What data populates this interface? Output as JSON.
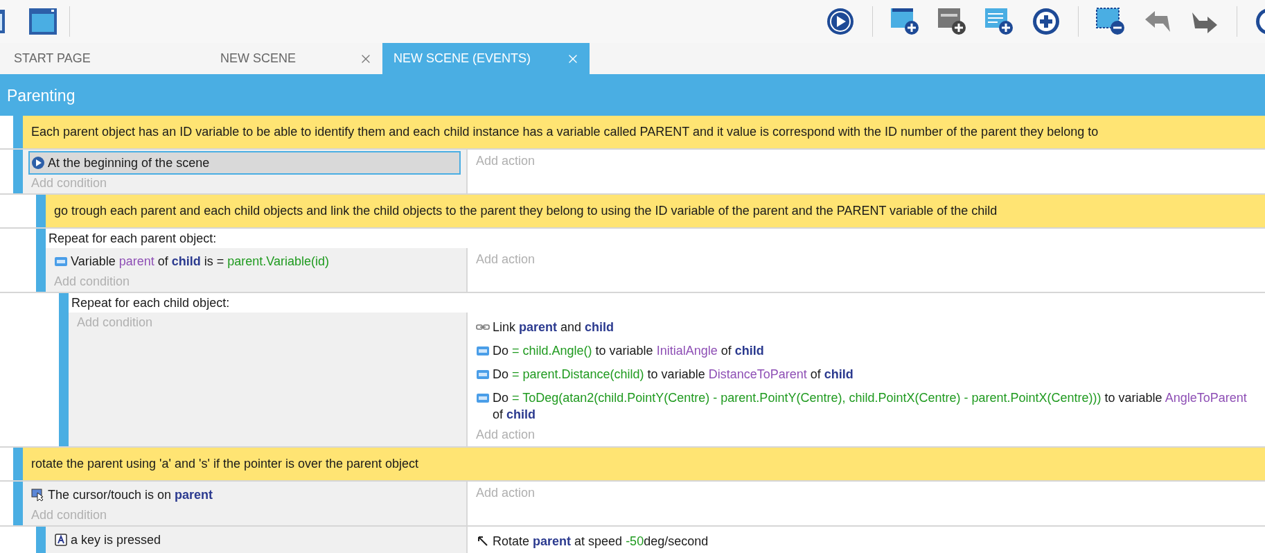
{
  "tabs": [
    {
      "label": "START PAGE",
      "closable": false,
      "selected": false
    },
    {
      "label": "NEW SCENE",
      "closable": true,
      "selected": false
    },
    {
      "label": "NEW SCENE (EVENTS)",
      "closable": true,
      "selected": true
    }
  ],
  "group": {
    "title": "Parenting"
  },
  "events": [
    {
      "kind": "comment",
      "text": "Each parent object has an ID variable to be able to identify them and each child instance has a variable called PARENT and it value is correspond with the ID number of the parent they belong to"
    },
    {
      "kind": "standard",
      "conditions": [
        {
          "kind": "scene",
          "selected": true,
          "parts": [
            {
              "text": "At the beginning of the scene",
              "kind": "plain"
            }
          ]
        }
      ],
      "add_condition": "Add condition",
      "add_action": "Add action",
      "children": [
        {
          "kind": "comment",
          "text": "go trough each parent and each child objects and link the child objects to the parent they belong to using the ID variable of the parent and the PARENT variable of the child"
        },
        {
          "kind": "repeat",
          "header": "Repeat for each parent object:",
          "conditions": [
            {
              "kind": "variable",
              "selected": false,
              "parts": [
                {
                  "text": "Variable ",
                  "kind": "plain"
                },
                {
                  "text": "parent",
                  "kind": "var"
                },
                {
                  "text": " of ",
                  "kind": "plain"
                },
                {
                  "text": "child",
                  "kind": "obj"
                },
                {
                  "text": " is = ",
                  "kind": "plain"
                },
                {
                  "text": "parent.Variable(id)",
                  "kind": "expr"
                }
              ]
            }
          ],
          "add_condition": "Add condition",
          "add_action": "Add action",
          "children": [
            {
              "kind": "repeat",
              "header": "Repeat for each child object:",
              "add_condition": "Add condition",
              "actions": [
                {
                  "kind": "link",
                  "parts": [
                    {
                      "text": "Link ",
                      "kind": "plain"
                    },
                    {
                      "text": "parent",
                      "kind": "obj"
                    },
                    {
                      "text": " and ",
                      "kind": "plain"
                    },
                    {
                      "text": "child",
                      "kind": "obj"
                    }
                  ]
                },
                {
                  "kind": "variable",
                  "parts": [
                    {
                      "text": "Do ",
                      "kind": "plain"
                    },
                    {
                      "text": "= child.Angle()",
                      "kind": "expr"
                    },
                    {
                      "text": " to variable ",
                      "kind": "plain"
                    },
                    {
                      "text": "InitialAngle",
                      "kind": "var"
                    },
                    {
                      "text": " of ",
                      "kind": "plain"
                    },
                    {
                      "text": "child",
                      "kind": "obj"
                    }
                  ]
                },
                {
                  "kind": "variable",
                  "parts": [
                    {
                      "text": "Do ",
                      "kind": "plain"
                    },
                    {
                      "text": "= parent.Distance(child)",
                      "kind": "expr"
                    },
                    {
                      "text": " to variable ",
                      "kind": "plain"
                    },
                    {
                      "text": "DistanceToParent",
                      "kind": "var"
                    },
                    {
                      "text": " of ",
                      "kind": "plain"
                    },
                    {
                      "text": "child",
                      "kind": "obj"
                    }
                  ]
                },
                {
                  "kind": "variable",
                  "parts": [
                    {
                      "text": "Do ",
                      "kind": "plain"
                    },
                    {
                      "text": "= ToDeg(atan2(child.PointY(Centre) - parent.PointY(Centre), child.PointX(Centre) - parent.PointX(Centre)))",
                      "kind": "expr"
                    },
                    {
                      "text": " to variable ",
                      "kind": "plain"
                    },
                    {
                      "text": "AngleToParent",
                      "kind": "var"
                    },
                    {
                      "text": " of ",
                      "kind": "plain"
                    },
                    {
                      "text": "child",
                      "kind": "obj"
                    }
                  ]
                }
              ],
              "add_action": "Add action"
            }
          ]
        }
      ]
    },
    {
      "kind": "comment",
      "text": "rotate the parent using 'a' and 's' if the pointer is over the parent object"
    },
    {
      "kind": "standard",
      "conditions": [
        {
          "kind": "cursor",
          "selected": false,
          "parts": [
            {
              "text": "The cursor/touch is on ",
              "kind": "plain"
            },
            {
              "text": "parent",
              "kind": "obj"
            }
          ]
        }
      ],
      "add_condition": "Add condition",
      "add_action": "Add action",
      "children": [
        {
          "kind": "standard",
          "conditions": [
            {
              "kind": "key",
              "selected": false,
              "parts": [
                {
                  "text": "a key is pressed",
                  "kind": "plain"
                }
              ]
            }
          ],
          "actions": [
            {
              "kind": "rotate",
              "parts": [
                {
                  "text": "Rotate ",
                  "kind": "plain"
                },
                {
                  "text": "parent",
                  "kind": "obj"
                },
                {
                  "text": " at speed ",
                  "kind": "plain"
                },
                {
                  "text": "-50",
                  "kind": "expr"
                },
                {
                  "text": "deg/second",
                  "kind": "plain"
                }
              ]
            }
          ]
        }
      ]
    }
  ]
}
